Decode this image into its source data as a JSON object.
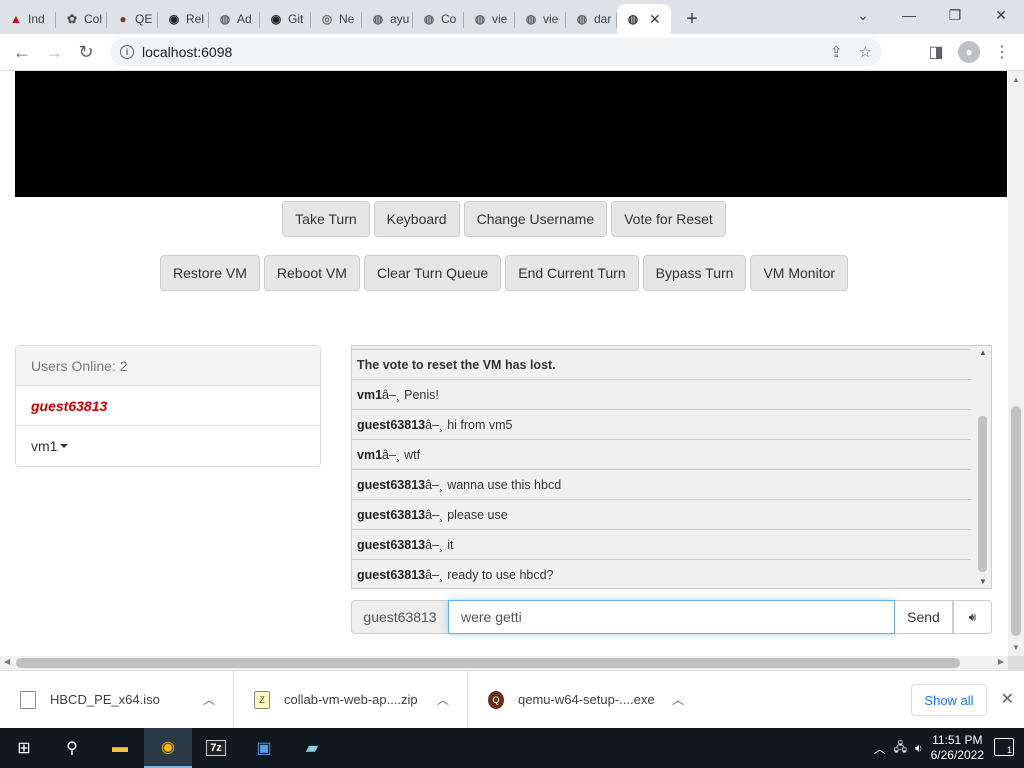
{
  "browser": {
    "tabs": [
      {
        "label": "Ind",
        "icon": "red-logo-icon"
      },
      {
        "label": "Col",
        "icon": "puzzle-icon"
      },
      {
        "label": "QE",
        "icon": "qemu-icon"
      },
      {
        "label": "Rel",
        "icon": "github-icon"
      },
      {
        "label": "Ad",
        "icon": "globe-icon"
      },
      {
        "label": "Git",
        "icon": "github-icon"
      },
      {
        "label": "Ne",
        "icon": "chrome-icon"
      },
      {
        "label": "ayu",
        "icon": "globe-icon"
      },
      {
        "label": "Co",
        "icon": "globe-icon"
      },
      {
        "label": "vie",
        "icon": "globe-icon"
      },
      {
        "label": "vie",
        "icon": "globe-icon"
      },
      {
        "label": "dar",
        "icon": "globe-icon"
      }
    ],
    "address": "localhost:6098"
  },
  "vm_controls": {
    "row1": [
      "Take Turn",
      "Keyboard",
      "Change Username",
      "Vote for Reset"
    ],
    "row2": [
      "Restore VM",
      "Reboot VM",
      "Clear Turn Queue",
      "End Current Turn",
      "Bypass Turn",
      "VM Monitor"
    ]
  },
  "users": {
    "header": "Users Online: 2",
    "list": [
      "guest63813",
      "vm1"
    ]
  },
  "chat": {
    "system_message": "The vote to reset the VM has lost.",
    "messages": [
      {
        "user": "vm1",
        "sep": "â–¸",
        "text": "Penis!"
      },
      {
        "user": "guest63813",
        "sep": "â–¸",
        "text": "hi from vm5"
      },
      {
        "user": "vm1",
        "sep": "â–¸",
        "text": "wtf"
      },
      {
        "user": "guest63813",
        "sep": "â–¸",
        "text": "wanna use this hbcd"
      },
      {
        "user": "guest63813",
        "sep": "â–¸",
        "text": "please use"
      },
      {
        "user": "guest63813",
        "sep": "â–¸",
        "text": "it"
      },
      {
        "user": "guest63813",
        "sep": "â–¸",
        "text": "ready to use hbcd?"
      }
    ],
    "username_label": "guest63813",
    "input_value": "were getti",
    "send_label": "Send"
  },
  "downloads": {
    "items": [
      "HBCD_PE_x64.iso",
      "collab-vm-web-ap....zip",
      "qemu-w64-setup-....exe"
    ],
    "show_all": "Show all"
  },
  "taskbar": {
    "time": "11:51 PM",
    "date": "6/26/2022",
    "notification_count": "1"
  }
}
